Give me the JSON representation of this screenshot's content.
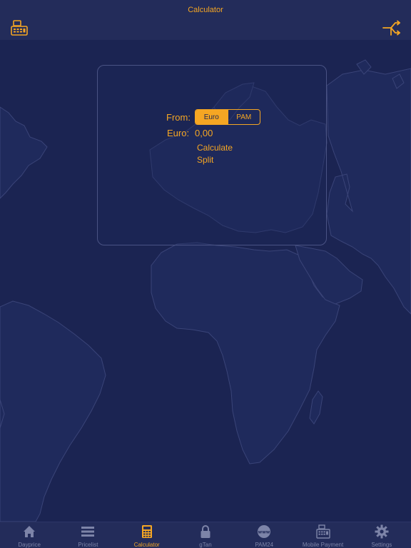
{
  "header": {
    "title": "Calculator"
  },
  "calculator": {
    "from_label": "From:",
    "options": [
      "Euro",
      "PAM"
    ],
    "selected": "Euro",
    "amount_label": "Euro:",
    "amount_value": "0,00",
    "calculate_label": "Calculate",
    "split_label": "Split"
  },
  "tabs": [
    {
      "label": "Dayprice",
      "icon": "house-icon"
    },
    {
      "label": "Pricelist",
      "icon": "list-icon"
    },
    {
      "label": "Calculator",
      "icon": "calculator-icon",
      "active": true
    },
    {
      "label": "gTan",
      "icon": "lock-icon"
    },
    {
      "label": "PAM24",
      "icon": "www-globe-icon"
    },
    {
      "label": "Mobile Payment",
      "icon": "cash-register-icon"
    },
    {
      "label": "Settings",
      "icon": "gear-icon"
    }
  ],
  "colors": {
    "background": "#1b2452",
    "bar": "#232c5a",
    "accent": "#f5a623",
    "inactive": "#7d84a8"
  }
}
